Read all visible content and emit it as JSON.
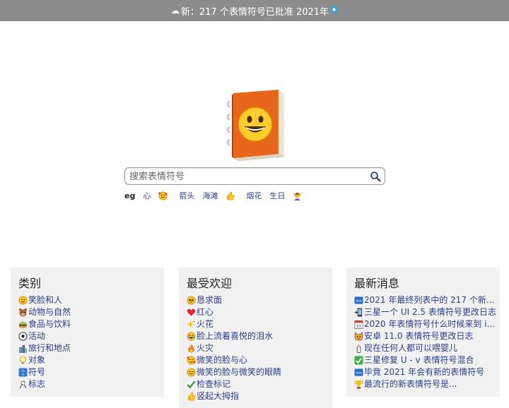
{
  "banner": {
    "text": "新：217 个表情符号已批准 2021年"
  },
  "search": {
    "placeholder": "搜索表情符号"
  },
  "examples": {
    "prefix": "eg",
    "items": [
      "心",
      "箭头",
      "海滩",
      "烟花",
      "生日"
    ]
  },
  "panels": [
    {
      "title": "类别",
      "items": [
        "笑脸和人",
        "动物与自然",
        "食品与饮料",
        "活动",
        "旅行和地点",
        "对象",
        "符号",
        "标志"
      ]
    },
    {
      "title": "最受欢迎",
      "items": [
        "恳求面",
        "红心",
        "火花",
        "脸上流着喜悦的泪水",
        "火灾",
        "微笑的脸与心",
        "微笑的脸与微笑的眼睛",
        "检查标记",
        "竖起大拇指"
      ]
    },
    {
      "title": "最新消息",
      "items": [
        "2021 年最终列表中的 217 个新...",
        "三星一个 UI 2.5 表情符号更改日志",
        "2020 年表情符号什么时候来到 ip...",
        "安卓 11.0 表情符号更改日志",
        "现在任何人都可以喂婴儿",
        "三星修复 U - v 表情符号混合",
        "毕竟 2021 年会有新的表情符号",
        "最流行的新表情符号是..."
      ]
    }
  ],
  "colors": {
    "banner_bg": "#8c8c8c",
    "panel_bg": "#f1f1f1",
    "link": "#2a3f8a",
    "book_orange": "#e8661b"
  }
}
